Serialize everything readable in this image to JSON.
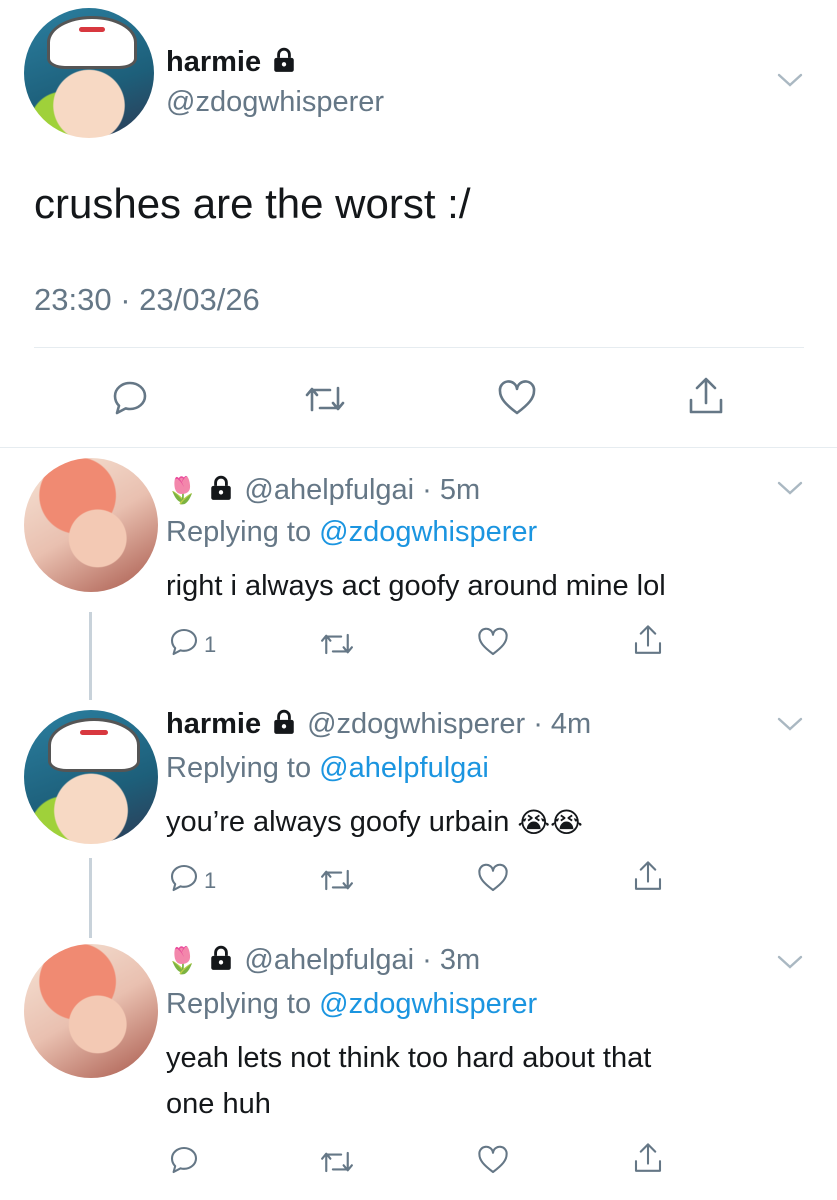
{
  "main_tweet": {
    "display_name": "harmie",
    "handle": "@zdogwhisperer",
    "text": "crushes are the worst :/",
    "timestamp": "23:30 · 23/03/26"
  },
  "replies": [
    {
      "prefix_emoji": "🌷",
      "display_name": "",
      "handle": "@ahelpfulgai · 5m",
      "replying_label": "Replying to",
      "replying_to": "@zdogwhisperer",
      "text": "right i always act goofy around mine lol",
      "reply_count": "1"
    },
    {
      "display_name": "harmie",
      "handle": "@zdogwhisperer · 4m",
      "replying_label": "Replying to",
      "replying_to": "@ahelpfulgai",
      "text": "you’re always goofy urbain",
      "emoji": "😭😭",
      "reply_count": "1"
    },
    {
      "prefix_emoji": "🌷",
      "display_name": "",
      "handle": "@ahelpfulgai · 3m",
      "replying_label": "Replying to",
      "replying_to": "@zdogwhisperer",
      "text_line1": "yeah lets not think too hard about that",
      "text_line2": "one huh"
    }
  ],
  "icons": [
    "lock-icon",
    "chevron-down-icon",
    "reply-icon",
    "retweet-icon",
    "like-icon",
    "share-icon"
  ]
}
